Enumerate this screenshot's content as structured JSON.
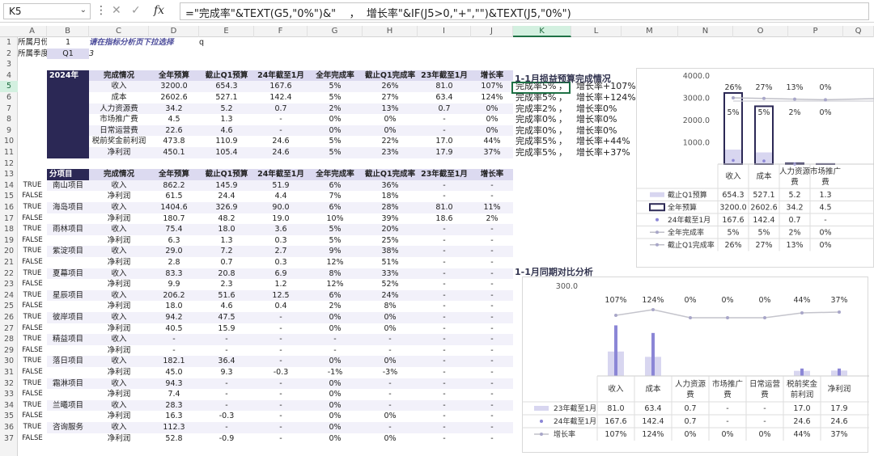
{
  "formula_bar": {
    "cell_ref": "K5",
    "formula": "=\"完成率\"&TEXT(G5,\"0%\")&\"    ，  增长率\"&IF(J5>0,\"+\",\"\")&TEXT(J5,\"0%\")"
  },
  "columns": [
    "A",
    "B",
    "C",
    "D",
    "E",
    "F",
    "G",
    "H",
    "I",
    "J",
    "K",
    "L",
    "M",
    "N",
    "O",
    "P",
    "Q"
  ],
  "selected_column": "K",
  "rows": [
    "1",
    "2",
    "3",
    "4",
    "5",
    "6",
    "7",
    "8",
    "9",
    "10",
    "11",
    "12",
    "13",
    "14",
    "15",
    "16",
    "17",
    "18",
    "19",
    "20",
    "21",
    "22",
    "23",
    "24",
    "25",
    "26",
    "27",
    "28",
    "29",
    "30",
    "31",
    "32",
    "33",
    "34",
    "35",
    "36",
    "37"
  ],
  "selected_row": "5",
  "top": {
    "month_label": "所属月份",
    "month_value": "1",
    "quarter_label": "所属季度",
    "quarter_value": "Q1",
    "note": "请在指标分析页下拉选择",
    "q_text": "q",
    "c2": "3"
  },
  "table1": {
    "year": "2024年",
    "headers": [
      "完成情况",
      "全年预算",
      "截止Q1预算",
      "24年截至1月",
      "全年完成率",
      "截止Q1完成率",
      "23年截至1月",
      "增长率"
    ],
    "rows": [
      [
        "收入",
        "3200.0",
        "654.3",
        "167.6",
        "5%",
        "26%",
        "81.0",
        "107%",
        "完成率5%",
        "，",
        "增长率+107%"
      ],
      [
        "成本",
        "2602.6",
        "527.1",
        "142.4",
        "5%",
        "27%",
        "63.4",
        "124%",
        "完成率5%",
        "，",
        "增长率+124%"
      ],
      [
        "人力资源费",
        "34.2",
        "5.2",
        "0.7",
        "2%",
        "13%",
        "0.7",
        "0%",
        "完成率2%",
        "，",
        "增长率0%"
      ],
      [
        "市场推广费",
        "4.5",
        "1.3",
        "-",
        "0%",
        "0%",
        "-",
        "0%",
        "完成率0%",
        "，",
        "增长率0%"
      ],
      [
        "日常运营费",
        "22.6",
        "4.6",
        "-",
        "0%",
        "0%",
        "-",
        "0%",
        "完成率0%",
        "，",
        "增长率0%"
      ],
      [
        "税前奖金前利润",
        "473.8",
        "110.9",
        "24.6",
        "5%",
        "22%",
        "17.0",
        "44%",
        "完成率5%",
        "，",
        "增长率+44%"
      ],
      [
        "净利润",
        "450.1",
        "105.4",
        "24.6",
        "5%",
        "23%",
        "17.9",
        "37%",
        "完成率5%",
        "，",
        "增长率+37%"
      ]
    ]
  },
  "table2": {
    "section": "分项目",
    "headers": [
      "完成情况",
      "全年预算",
      "截止Q1预算",
      "24年截至1月",
      "全年完成率",
      "截止Q1完成率",
      "23年截至1月",
      "增长率"
    ],
    "rows": [
      [
        "TRUE",
        "南山项目",
        "收入",
        "862.2",
        "145.9",
        "51.9",
        "6%",
        "36%",
        "-",
        "-"
      ],
      [
        "FALSE",
        "",
        "净利润",
        "61.5",
        "24.4",
        "4.4",
        "7%",
        "18%",
        "-",
        "-"
      ],
      [
        "TRUE",
        "海岛项目",
        "收入",
        "1404.6",
        "326.9",
        "90.0",
        "6%",
        "28%",
        "81.0",
        "11%"
      ],
      [
        "FALSE",
        "",
        "净利润",
        "180.7",
        "48.2",
        "19.0",
        "10%",
        "39%",
        "18.6",
        "2%"
      ],
      [
        "TRUE",
        "雨林项目",
        "收入",
        "75.4",
        "18.0",
        "3.6",
        "5%",
        "20%",
        "-",
        "-"
      ],
      [
        "FALSE",
        "",
        "净利润",
        "6.3",
        "1.3",
        "0.3",
        "5%",
        "25%",
        "-",
        "-"
      ],
      [
        "TRUE",
        "紫淀项目",
        "收入",
        "29.0",
        "7.2",
        "2.7",
        "9%",
        "38%",
        "-",
        "-"
      ],
      [
        "FALSE",
        "",
        "净利润",
        "2.8",
        "0.7",
        "0.3",
        "12%",
        "51%",
        "-",
        "-"
      ],
      [
        "TRUE",
        "夏幕项目",
        "收入",
        "83.3",
        "20.8",
        "6.9",
        "8%",
        "33%",
        "-",
        "-"
      ],
      [
        "FALSE",
        "",
        "净利润",
        "9.9",
        "2.3",
        "1.2",
        "12%",
        "52%",
        "-",
        "-"
      ],
      [
        "TRUE",
        "星辰项目",
        "收入",
        "206.2",
        "51.6",
        "12.5",
        "6%",
        "24%",
        "-",
        "-"
      ],
      [
        "FALSE",
        "",
        "净利润",
        "18.0",
        "4.6",
        "0.4",
        "2%",
        "8%",
        "-",
        "-"
      ],
      [
        "TRUE",
        "彼岸项目",
        "收入",
        "94.2",
        "47.5",
        "-",
        "0%",
        "0%",
        "-",
        "-"
      ],
      [
        "FALSE",
        "",
        "净利润",
        "40.5",
        "15.9",
        "-",
        "0%",
        "0%",
        "-",
        "-"
      ],
      [
        "TRUE",
        "精益项目",
        "收入",
        "-",
        "-",
        "-",
        "-",
        "-",
        "-",
        "-"
      ],
      [
        "FALSE",
        "",
        "净利润",
        "-",
        "-",
        "-",
        "-",
        "-",
        "-",
        "-"
      ],
      [
        "TRUE",
        "落日项目",
        "收入",
        "182.1",
        "36.4",
        "-",
        "0%",
        "0%",
        "-",
        "-"
      ],
      [
        "FALSE",
        "",
        "净利润",
        "45.0",
        "9.3",
        "-0.3",
        "-1%",
        "-3%",
        "-",
        "-"
      ],
      [
        "TRUE",
        "霜淋项目",
        "收入",
        "94.3",
        "-",
        "-",
        "0%",
        "-",
        "-",
        "-"
      ],
      [
        "FALSE",
        "",
        "净利润",
        "7.4",
        "-",
        "-",
        "0%",
        "-",
        "-",
        "-"
      ],
      [
        "TRUE",
        "兰曦项目",
        "收入",
        "28.3",
        "-",
        "-",
        "0%",
        "-",
        "-",
        "-"
      ],
      [
        "FALSE",
        "",
        "净利润",
        "16.3",
        "-0.3",
        "-",
        "0%",
        "0%",
        "-",
        "-"
      ],
      [
        "TRUE",
        "咨询服务",
        "收入",
        "112.3",
        "-",
        "-",
        "0%",
        "-",
        "-",
        "-"
      ],
      [
        "FALSE",
        "",
        "净利润",
        "52.8",
        "-0.9",
        "-",
        "0%",
        "0%",
        "-",
        "-"
      ]
    ]
  },
  "chart1_title": "1-1月损益预算完成情况",
  "chart2_title": "1-1月同期对比分析",
  "chart_data": [
    {
      "type": "bar",
      "title": "",
      "y_ticks": [
        "4000.0",
        "3000.0",
        "2000.0",
        "1000.0"
      ],
      "ylim": [
        0,
        4000
      ],
      "categories": [
        "收入",
        "成本",
        "人力资源费",
        "市场推广费"
      ],
      "series": [
        {
          "name": "截止Q1预算",
          "values": [
            654.3,
            527.1,
            5.2,
            1.3
          ]
        },
        {
          "name": "全年预算",
          "values": [
            3200.0,
            2602.6,
            34.2,
            4.5
          ]
        },
        {
          "name": "24年截至1月",
          "values": [
            167.6,
            142.4,
            0.7,
            null
          ]
        },
        {
          "name": "全年完成率",
          "values": [
            "5%",
            "5%",
            "2%",
            "0%"
          ]
        },
        {
          "name": "截止Q1完成率",
          "values": [
            "26%",
            "27%",
            "13%",
            "0%"
          ]
        }
      ],
      "top_labels": [
        "26%",
        "27%",
        "13%",
        "0%"
      ],
      "inner_labels": [
        "5%",
        "5%",
        "2%",
        "0%"
      ],
      "table": [
        [
          "截止Q1预算",
          "654.3",
          "527.1",
          "5.2",
          "1.3"
        ],
        [
          "全年预算",
          "3200.0",
          "2602.6",
          "34.2",
          "4.5"
        ],
        [
          "24年截至1月",
          "167.6",
          "142.4",
          "0.7",
          "-"
        ],
        [
          "全年完成率",
          "5%",
          "5%",
          "2%",
          "0%"
        ],
        [
          "截止Q1完成率",
          "26%",
          "27%",
          "13%",
          "0%"
        ]
      ]
    },
    {
      "type": "bar",
      "title": "",
      "y_ticks": [
        "300.0"
      ],
      "ylim": [
        0,
        300
      ],
      "categories": [
        "收入",
        "成本",
        "人力资源费",
        "市场推广费",
        "日常运营费",
        "税前奖金前利润",
        "净利润"
      ],
      "series": [
        {
          "name": "23年截至1月",
          "values": [
            81.0,
            63.4,
            0.7,
            null,
            null,
            17.0,
            17.9
          ]
        },
        {
          "name": "24年截至1月",
          "values": [
            167.6,
            142.4,
            0.7,
            null,
            null,
            24.6,
            24.6
          ]
        },
        {
          "name": "增长率",
          "values": [
            "107%",
            "124%",
            "0%",
            "0%",
            "0%",
            "44%",
            "37%"
          ]
        }
      ],
      "top_labels": [
        "107%",
        "124%",
        "0%",
        "0%",
        "0%",
        "44%",
        "37%"
      ],
      "table": [
        [
          "23年截至1月",
          "81.0",
          "63.4",
          "0.7",
          "-",
          "-",
          "17.0",
          "17.9"
        ],
        [
          "24年截至1月",
          "167.6",
          "142.4",
          "0.7",
          "-",
          "-",
          "24.6",
          "24.6"
        ],
        [
          "增长率",
          "107%",
          "124%",
          "0%",
          "0%",
          "0%",
          "44%",
          "37%"
        ]
      ]
    }
  ],
  "colors": {
    "dark": "#2b2855",
    "header": "#dcdaf0",
    "bar_light": "#d8d6f0",
    "bar_mid": "#8b86d6",
    "line": "#b8b8c8",
    "select": "#1e7145"
  }
}
